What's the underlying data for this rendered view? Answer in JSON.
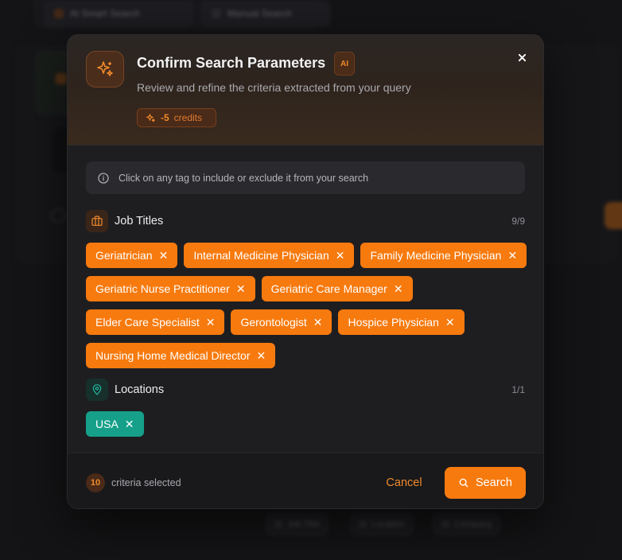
{
  "background": {
    "tabs": [
      {
        "label": "AI Smart Search"
      },
      {
        "label": "Manual Search"
      }
    ],
    "bottom_chips": [
      {
        "label": "Job Title"
      },
      {
        "label": "Location"
      },
      {
        "label": "Company"
      }
    ]
  },
  "modal": {
    "title": "Confirm Search Parameters",
    "ai_badge": "AI",
    "subtitle": "Review and refine the criteria extracted from your query",
    "credits": {
      "amount": "-5",
      "label": "credits"
    },
    "info": "Click on any tag to include or exclude it from your search",
    "sections": {
      "job_titles": {
        "label": "Job Titles",
        "count": "9/9",
        "tags": [
          "Geriatrician",
          "Internal Medicine Physician",
          "Family Medicine Physician",
          "Geriatric Nurse Practitioner",
          "Geriatric Care Manager",
          "Elder Care Specialist",
          "Gerontologist",
          "Hospice Physician",
          "Nursing Home Medical Director"
        ]
      },
      "locations": {
        "label": "Locations",
        "count": "1/1",
        "tags": [
          "USA"
        ]
      }
    },
    "footer": {
      "selected_count": "10",
      "selected_label": "criteria selected",
      "cancel": "Cancel",
      "search": "Search"
    }
  },
  "colors": {
    "accent": "#f77a0e",
    "location_tag": "#16a08a",
    "modal_bg": "#1e1e21"
  },
  "icons": {
    "header": "sparkles-icon",
    "close": "close-icon",
    "info": "info-icon",
    "job_titles": "briefcase-icon",
    "locations": "map-pin-icon",
    "search": "search-icon"
  }
}
